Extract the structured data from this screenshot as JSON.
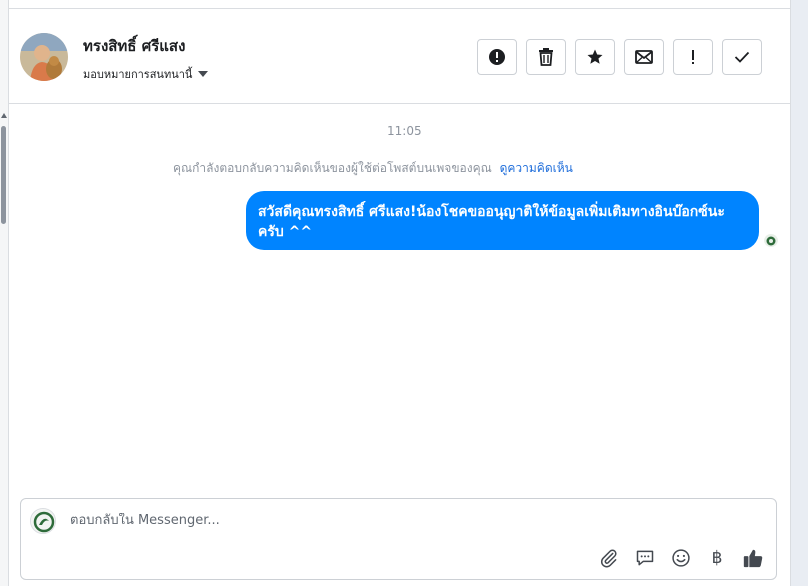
{
  "conversation": {
    "contact_name": "ทรงสิทธิ์ ศรีแสง",
    "assign_label": "มอบหมายการสนทนานี้"
  },
  "actions": [
    {
      "name": "mark-spam",
      "icon": "alert-circle-icon"
    },
    {
      "name": "delete",
      "icon": "trash-icon"
    },
    {
      "name": "star",
      "icon": "star-icon"
    },
    {
      "name": "mark-unread",
      "icon": "envelope-icon"
    },
    {
      "name": "follow-up",
      "icon": "exclamation-icon"
    },
    {
      "name": "mark-done",
      "icon": "check-icon"
    }
  ],
  "messages": {
    "timestamp": "11:05",
    "notice_text": "คุณกำลังตอบกลับความคิดเห็นของผู้ใช้ต่อโพสต์บนเพจของคุณ",
    "notice_link": "ดูความคิดเห็น",
    "outgoing_text": "สวัสดีคุณทรงสิทธิ์ ศรีแสง!น้องโชคขออนุญาติให้ข้อมูลเพิ่มเติมทางอินบ๊อกซ์นะครับ ^^"
  },
  "composer": {
    "placeholder": "ตอบกลับใน Messenger...",
    "currency_symbol": "฿",
    "tools": [
      "paperclip-icon",
      "saved-reply-icon",
      "emoji-icon",
      "baht-icon",
      "thumbs-up-icon"
    ]
  },
  "colors": {
    "bubble": "#0084ff",
    "link": "#216fdb",
    "muted": "#8d949e"
  }
}
